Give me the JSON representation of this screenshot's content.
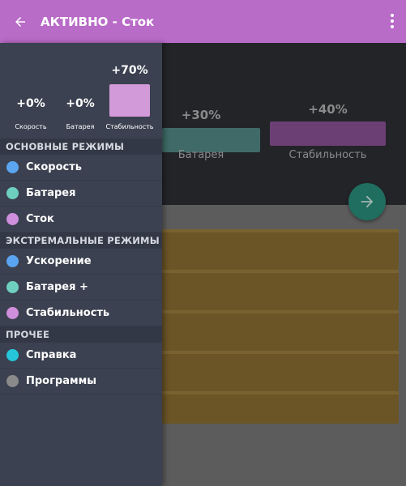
{
  "app_bar": {
    "title_main": "АКТИВНО",
    "title_sep": " - ",
    "title_sub": "Сток"
  },
  "background": {
    "bars": [
      {
        "percent": "+30%",
        "label": "Батарея",
        "color": "#3f6a67"
      },
      {
        "percent": "+40%",
        "label": "Стабильность",
        "color": "#6b3f74"
      }
    ],
    "fab_color": "#1f6e5f",
    "card_color": "#6b5526"
  },
  "drawer": {
    "stats": [
      {
        "percent": "+0%",
        "label": "Скорость"
      },
      {
        "percent": "+0%",
        "label": "Батарея"
      },
      {
        "percent": "+70%",
        "label": "Стабильность",
        "color": "#d39ad9"
      }
    ],
    "sections": [
      {
        "title": "ОСНОВНЫЕ РЕЖИМЫ",
        "items": [
          {
            "label": "Скорость",
            "color": "#5ba5f0"
          },
          {
            "label": "Батарея",
            "color": "#6fcfbf"
          },
          {
            "label": "Сток",
            "color": "#cf8fdc"
          }
        ]
      },
      {
        "title": "ЭКСТРЕМАЛЬНЫЕ РЕЖИМЫ",
        "items": [
          {
            "label": "Ускорение",
            "color": "#5ba5f0"
          },
          {
            "label": "Батарея +",
            "color": "#6fcfbf"
          },
          {
            "label": "Стабильность",
            "color": "#cf8fdc"
          }
        ]
      },
      {
        "title": "ПРОЧЕЕ",
        "items": [
          {
            "label": "Справка",
            "color": "#26c6da"
          },
          {
            "label": "Программы",
            "color": "#8a8a8a"
          }
        ]
      }
    ]
  },
  "colors": {
    "app_bar": "#b86bc7",
    "drawer": "#3b4150"
  },
  "icons": {
    "back": "arrow-left-icon",
    "more": "more-vertical-icon",
    "fab": "arrow-right-icon"
  }
}
